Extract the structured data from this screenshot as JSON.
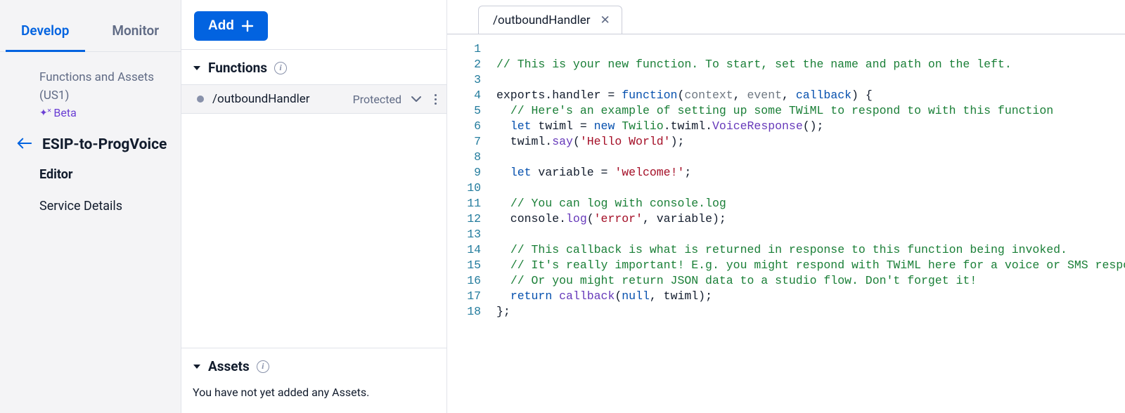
{
  "sidebar": {
    "tabs": {
      "develop": "Develop",
      "monitor": "Monitor"
    },
    "crumb_line1": "Functions and Assets",
    "crumb_line2": "(US1)",
    "beta": "Beta",
    "service_name": "ESIP-to-ProgVoice",
    "nav": {
      "editor": "Editor",
      "service_details": "Service Details"
    }
  },
  "mid": {
    "add": "Add",
    "functions_header": "Functions",
    "assets_header": "Assets",
    "functions": [
      {
        "name": "/outboundHandler",
        "visibility": "Protected"
      }
    ],
    "assets_empty": "You have not yet added any Assets."
  },
  "editor": {
    "tab_label": "/outboundHandler",
    "lines": [
      [],
      [
        {
          "c": "tok-comment",
          "t": "// This is your new function. To start, set the name and path on the left."
        }
      ],
      [],
      [
        {
          "t": "exports.handler = "
        },
        {
          "c": "tok-kw",
          "t": "function"
        },
        {
          "t": "("
        },
        {
          "c": "tok-arg",
          "t": "context"
        },
        {
          "t": ", "
        },
        {
          "c": "tok-arg",
          "t": "event"
        },
        {
          "t": ", "
        },
        {
          "c": "tok-argkw",
          "t": "callback"
        },
        {
          "t": ") {"
        }
      ],
      [
        {
          "t": "  "
        },
        {
          "c": "tok-comment",
          "t": "// Here's an example of setting up some TWiML to respond to with this function"
        }
      ],
      [
        {
          "t": "  "
        },
        {
          "c": "tok-kw",
          "t": "let"
        },
        {
          "t": " twiml = "
        },
        {
          "c": "tok-kw",
          "t": "new"
        },
        {
          "t": " "
        },
        {
          "c": "tok-type",
          "t": "Twilio"
        },
        {
          "t": ".twiml."
        },
        {
          "c": "tok-fn",
          "t": "VoiceResponse"
        },
        {
          "t": "();"
        }
      ],
      [
        {
          "t": "  twiml."
        },
        {
          "c": "tok-fn",
          "t": "say"
        },
        {
          "t": "("
        },
        {
          "c": "tok-str",
          "t": "'Hello World'"
        },
        {
          "t": ");"
        }
      ],
      [],
      [
        {
          "t": "  "
        },
        {
          "c": "tok-kw",
          "t": "let"
        },
        {
          "t": " variable = "
        },
        {
          "c": "tok-str",
          "t": "'welcome!'"
        },
        {
          "t": ";"
        }
      ],
      [],
      [
        {
          "t": "  "
        },
        {
          "c": "tok-comment",
          "t": "// You can log with console.log"
        }
      ],
      [
        {
          "t": "  console."
        },
        {
          "c": "tok-fn",
          "t": "log"
        },
        {
          "t": "("
        },
        {
          "c": "tok-str",
          "t": "'error'"
        },
        {
          "t": ", variable);"
        }
      ],
      [],
      [
        {
          "t": "  "
        },
        {
          "c": "tok-comment",
          "t": "// This callback is what is returned in response to this function being invoked."
        }
      ],
      [
        {
          "t": "  "
        },
        {
          "c": "tok-comment",
          "t": "// It's really important! E.g. you might respond with TWiML here for a voice or SMS response."
        }
      ],
      [
        {
          "t": "  "
        },
        {
          "c": "tok-comment",
          "t": "// Or you might return JSON data to a studio flow. Don't forget it!"
        }
      ],
      [
        {
          "t": "  "
        },
        {
          "c": "tok-kw",
          "t": "return"
        },
        {
          "t": " "
        },
        {
          "c": "tok-fn",
          "t": "callback"
        },
        {
          "t": "("
        },
        {
          "c": "tok-const",
          "t": "null"
        },
        {
          "t": ", twiml);"
        }
      ],
      [
        {
          "t": "};"
        }
      ]
    ]
  }
}
